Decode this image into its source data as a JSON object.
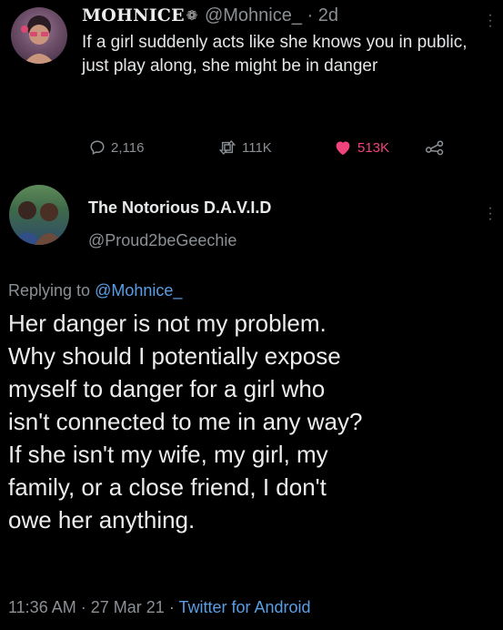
{
  "original_tweet": {
    "display_name": "MOHNICE",
    "name_emoji_icon": "flower-icon",
    "handle": "@Mohnice_",
    "separator": "·",
    "age": "2d",
    "text": "If a girl suddenly acts like she knows you in public, just play along, she might be in danger",
    "actions": {
      "replies": "2,116",
      "retweets": "111K",
      "likes": "513K"
    },
    "like_color": "#f0437c"
  },
  "reply_tweet": {
    "display_name": "The Notorious D.A.V.I.D",
    "handle": "@Proud2beGeechie",
    "replying_prefix": "Replying to",
    "replying_to": "@Mohnice_",
    "text_lines": [
      "Her danger is not my problem.",
      "Why should I potentially expose",
      "myself to danger for a girl who",
      "isn't connected to me in any way?",
      "If she isn't my wife, my girl, my",
      "family, or a close friend, I don't",
      "owe her anything."
    ],
    "time": "11:36 AM",
    "date": "27 Mar 21",
    "separator": "·",
    "client": "Twitter for Android",
    "link_color": "#5a9ee6"
  }
}
